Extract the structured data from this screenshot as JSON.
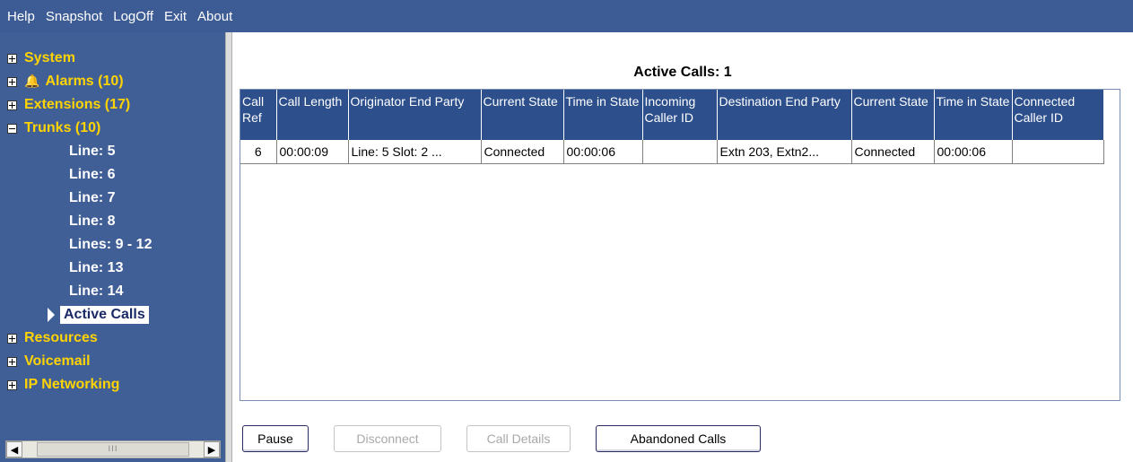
{
  "menu": [
    "Help",
    "Snapshot",
    "LogOff",
    "Exit",
    "About"
  ],
  "sidebar": {
    "system": "System",
    "alarms": "Alarms (10)",
    "extensions": "Extensions (17)",
    "trunks": "Trunks (10)",
    "lines": [
      "Line: 5",
      "Line: 6",
      "Line: 7",
      "Line: 8",
      "Lines: 9 - 12",
      "Line: 13",
      "Line: 14"
    ],
    "active_calls": "Active Calls",
    "resources": "Resources",
    "voicemail": "Voicemail",
    "ip_networking": "IP Networking",
    "scroll_thumb": "III"
  },
  "main": {
    "title": "Active Calls: 1",
    "columns": [
      "Call Ref",
      "Call Length",
      "Originator End Party",
      "Current State",
      "Time in State",
      "Incoming Caller ID",
      "Destination End Party",
      "Current State",
      "Time in State",
      "Connected Caller ID"
    ],
    "rows": [
      [
        "6",
        "00:00:09",
        "Line: 5  Slot: 2  ...",
        "Connected",
        "00:00:06",
        "",
        "Extn 203, Extn2...",
        "Connected",
        "00:00:06",
        ""
      ]
    ]
  },
  "buttons": {
    "pause": "Pause",
    "disconnect": "Disconnect",
    "call_details": "Call Details",
    "abandoned_calls": "Abandoned Calls"
  }
}
